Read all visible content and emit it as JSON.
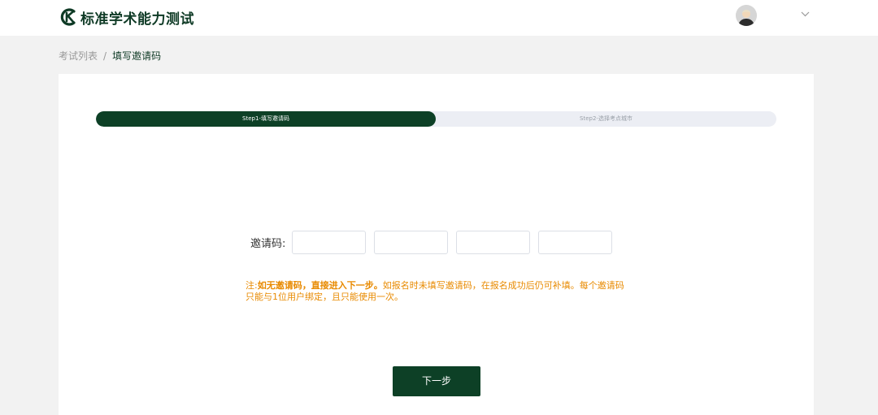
{
  "header": {
    "logo_text": "标准学术能力测试",
    "user_menu_icon": "chevron-down-icon",
    "avatar_icon": "user-avatar-icon"
  },
  "breadcrumb": {
    "parent": "考试列表",
    "separator": "/",
    "current": "填写邀请码"
  },
  "steps": [
    {
      "label": "Step1-填写邀请码",
      "active": true
    },
    {
      "label": "Step2-选择考点城市",
      "active": false
    }
  ],
  "form": {
    "label": "邀请码:",
    "inputs": [
      "",
      "",
      "",
      ""
    ]
  },
  "note": {
    "prefix": "注:",
    "bold": "如无邀请码，直接进入下一步。",
    "text": "如报名时未填写邀请码，在报名成功后仍可补填。每个邀请码只能与1位用户绑定，且只能使用一次。"
  },
  "next_button": "下一步",
  "colors": {
    "brand": "#0d4026",
    "note": "#e88a00",
    "step_inactive_bg": "#eceef4"
  }
}
